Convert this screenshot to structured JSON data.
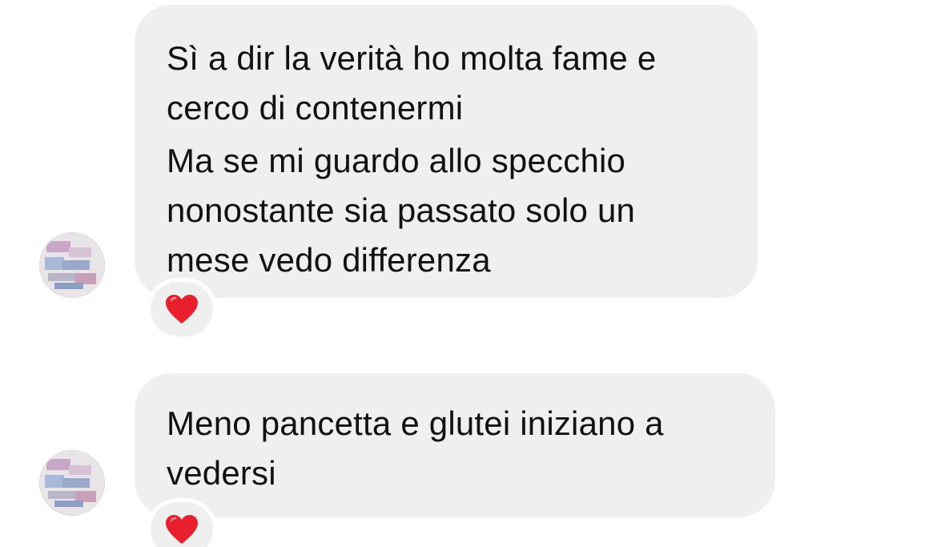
{
  "messages": [
    {
      "paragraphs": [
        "Sì a dir la verità ho molta fame e cerco di contenermi",
        "Ma se mi guardo allo specchio nonostante sia passato solo un mese vedo differenza"
      ],
      "reaction": "heart-icon"
    },
    {
      "paragraphs": [
        "Meno pancetta e glutei iniziano a vedersi"
      ],
      "reaction": "heart-icon"
    }
  ],
  "colors": {
    "bubble": "#efefef",
    "text": "#111111",
    "heart": "#e8202e"
  }
}
